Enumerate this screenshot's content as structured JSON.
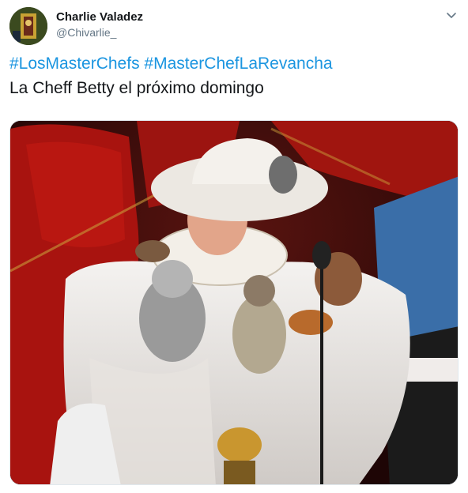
{
  "author": {
    "display_name": "Charlie Valadez",
    "handle": "@Chivarlie_"
  },
  "tweet": {
    "hashtags": [
      "#LosMasterChefs",
      "#MasterChefLaRevancha"
    ],
    "text": "La Cheff Betty el próximo domingo"
  },
  "icons": {
    "menu": "chevron-down-icon"
  },
  "colors": {
    "link": "#1b95e0",
    "text": "#14171a",
    "muted": "#657786"
  }
}
